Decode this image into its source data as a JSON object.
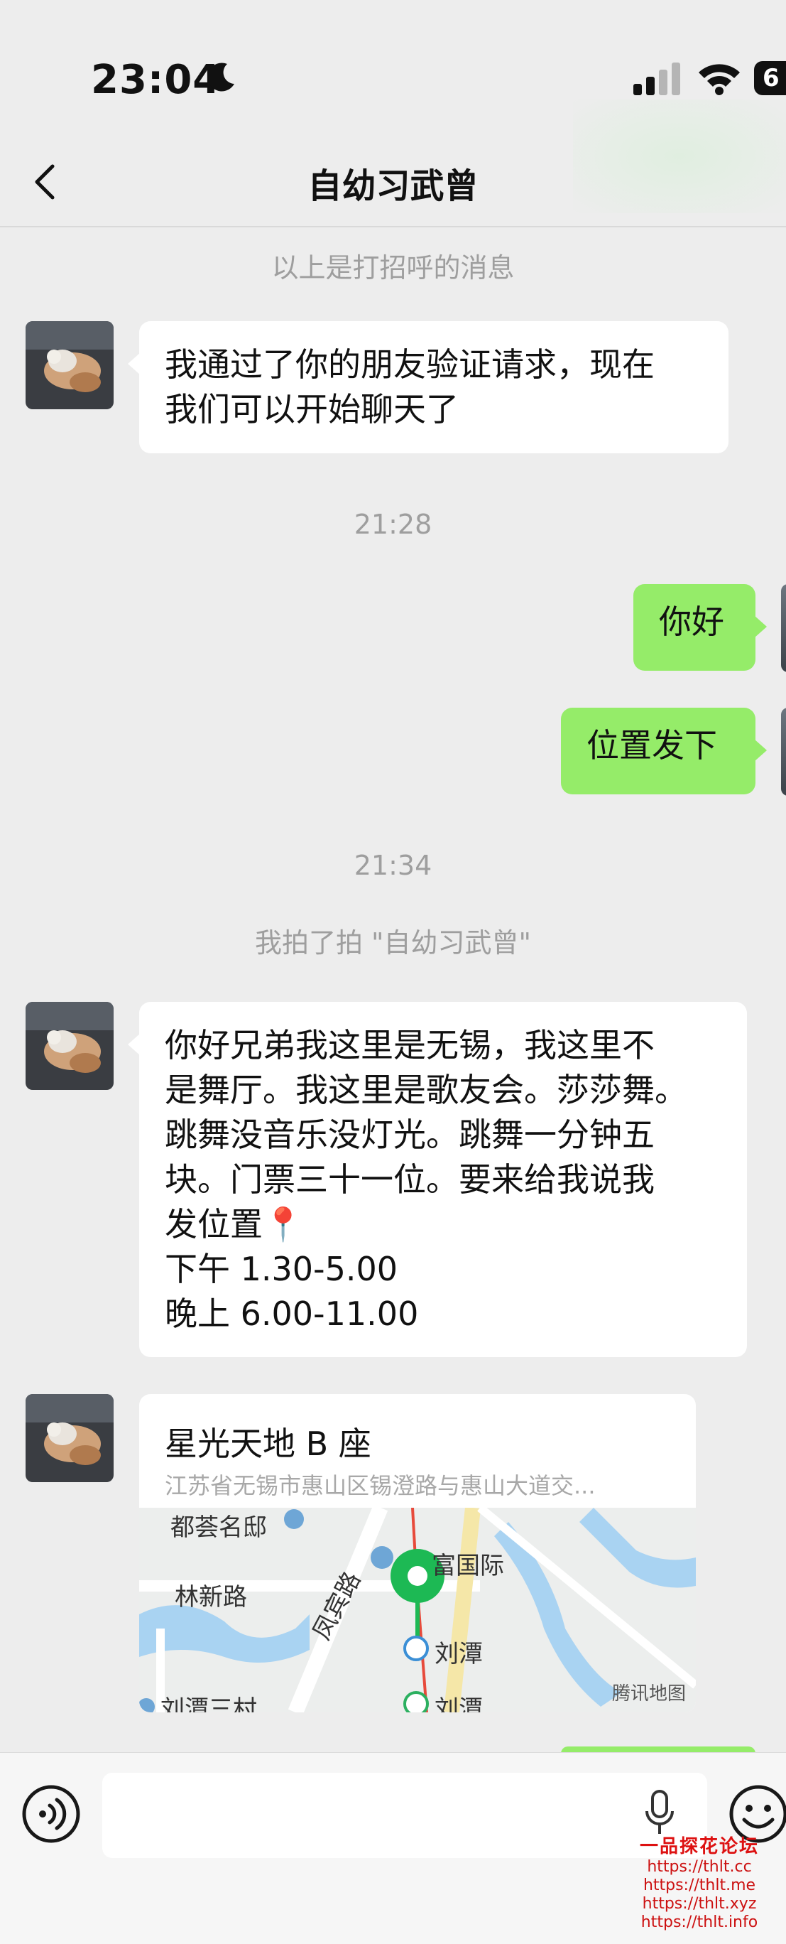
{
  "status_bar": {
    "time": "23:04",
    "battery": "6"
  },
  "navbar": {
    "title": "自幼习武曾"
  },
  "messages": {
    "greeting_notice": "以上是打招呼的消息",
    "friend_accept": [
      "我通过了你的朋友验证请求，现在",
      "我们可以开始聊天了"
    ],
    "time1": "21:28",
    "me_hello": "你好",
    "me_location": "位置发下",
    "time2": "21:34",
    "pat_notice": "我拍了拍 \"自幼习武曾\"",
    "long_msg": [
      "你好兄弟我这里是无锡，我这里不",
      "是舞厅。我这里是歌友会。莎莎舞。",
      "跳舞没音乐没灯光。跳舞一分钟五",
      "块。门票三十一位。要来给我说我",
      "发位置📍",
      "下午 1.30-5.00",
      "晚上 6.00-11.00"
    ]
  },
  "location": {
    "name": "星光天地 B 座",
    "address": "江苏省无锡市惠山区锡澄路与惠山大道交...",
    "map_labels": {
      "a": "都荟名邸",
      "b": "林新路",
      "c": "凤宾路",
      "d": "富国际",
      "e": "刘潭",
      "f": "刘潭",
      "g": "刘潭三村"
    },
    "brand": "腾讯地图"
  },
  "input": {
    "placeholder": ""
  },
  "watermark": {
    "title": "一品探花论坛",
    "urls": [
      "https://thlt.cc",
      "https://thlt.me",
      "https://thlt.xyz",
      "https://thlt.info"
    ]
  },
  "colors": {
    "chat_bg": "#ededed",
    "bubble_self": "#95ec69",
    "bubble_other": "#ffffff",
    "system_text": "#9e9e9e"
  }
}
